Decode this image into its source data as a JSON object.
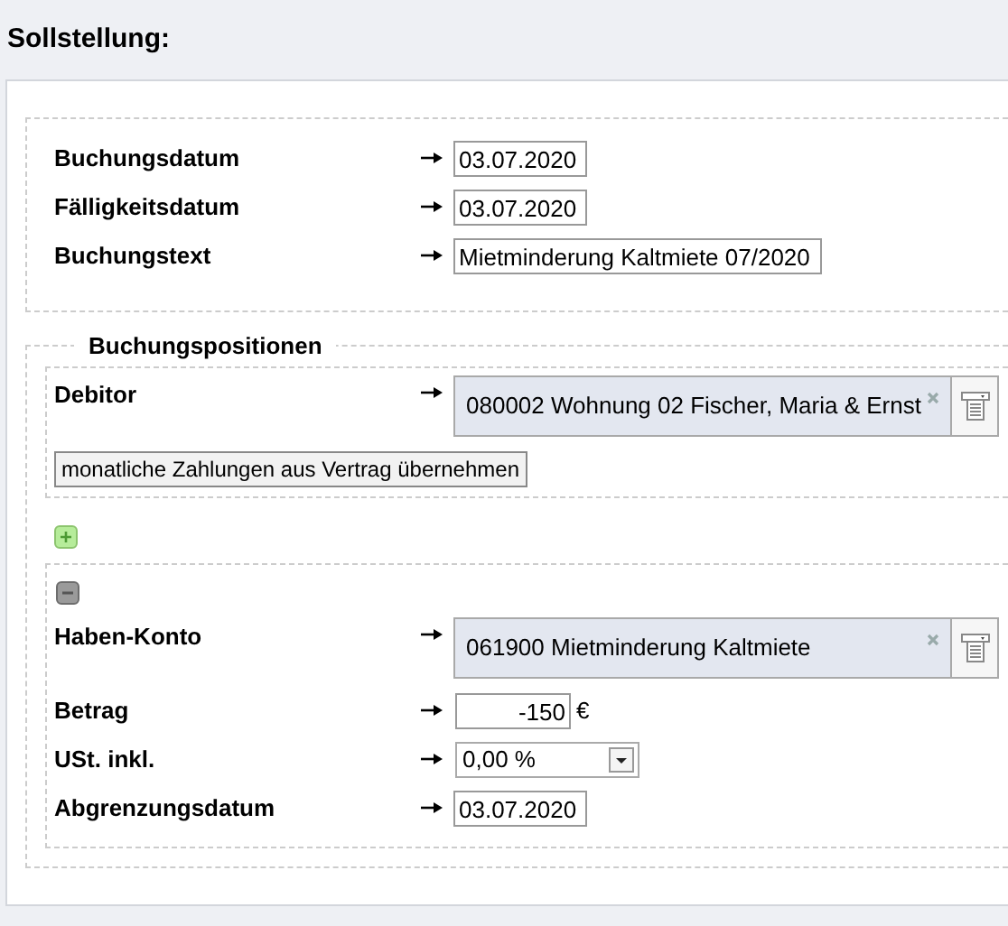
{
  "title": "Sollstellung:",
  "header_fields": [
    {
      "label": "Buchungsdatum",
      "kind": "date",
      "value": "03.07.2020"
    },
    {
      "label": "Fälligkeitsdatum",
      "kind": "date",
      "value": "03.07.2020"
    },
    {
      "label": "Buchungstext",
      "kind": "text",
      "value": "Mietminderung Kaltmiete 07/2020"
    }
  ],
  "positions": {
    "legend": "Buchungspositionen",
    "debitor": {
      "label": "Debitor",
      "kind": "lookup",
      "value": "080002 Wohnung 02 Fischer, Maria & Ernst"
    },
    "copy_button": "monatliche Zahlungen aus Vertrag übernehmen",
    "lines": [
      {
        "fields": [
          {
            "label": "Haben-Konto",
            "kind": "lookup",
            "value": "061900 Mietminderung Kaltmiete"
          },
          {
            "label": "Betrag",
            "kind": "amount",
            "value": "-150",
            "unit": "€"
          },
          {
            "label": "USt. inkl.",
            "kind": "select",
            "value": "0,00 %"
          },
          {
            "label": "Abgrenzungsdatum",
            "kind": "date",
            "value": "03.07.2020"
          }
        ]
      }
    ]
  }
}
